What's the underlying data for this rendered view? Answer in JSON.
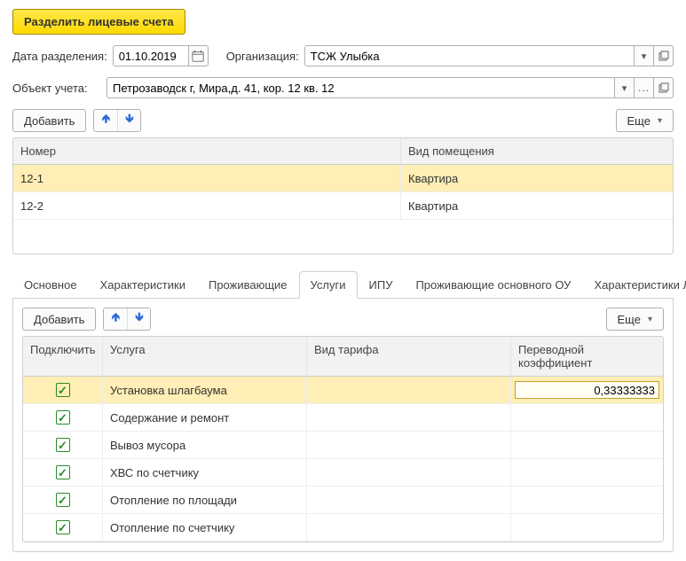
{
  "main_button": "Разделить лицевые счета",
  "date_label": "Дата разделения:",
  "date_value": "01.10.2019",
  "org_label": "Организация:",
  "org_value": "ТСЖ Улыбка",
  "object_label": "Объект учета:",
  "object_value": "Петрозаводск г, Мира,д. 41, кор. 12 кв. 12",
  "add_label": "Добавить",
  "more_label": "Еще",
  "accounts_table": {
    "columns": [
      "Номер",
      "Вид помещения"
    ],
    "rows": [
      {
        "num": "12-1",
        "type": "Квартира",
        "selected": true
      },
      {
        "num": "12-2",
        "type": "Квартира",
        "selected": false
      }
    ]
  },
  "tabs": [
    "Основное",
    "Характеристики",
    "Проживающие",
    "Услуги",
    "ИПУ",
    "Проживающие основного ОУ",
    "Характеристики ЛС"
  ],
  "active_tab": "Услуги",
  "services_table": {
    "columns": [
      "Подключить",
      "Услуга",
      "Вид тарифа",
      "Переводной коэффициент"
    ],
    "rows": [
      {
        "on": true,
        "service": "Установка шлагбаума",
        "tariff": "",
        "coef": "0,33333333",
        "selected": true
      },
      {
        "on": true,
        "service": "Содержание и ремонт",
        "tariff": "",
        "coef": ""
      },
      {
        "on": true,
        "service": "Вывоз мусора",
        "tariff": "",
        "coef": ""
      },
      {
        "on": true,
        "service": "ХВС по счетчику",
        "tariff": "",
        "coef": ""
      },
      {
        "on": true,
        "service": "Отопление по площади",
        "tariff": "",
        "coef": ""
      },
      {
        "on": true,
        "service": "Отопление по счетчику",
        "tariff": "",
        "coef": ""
      }
    ]
  }
}
